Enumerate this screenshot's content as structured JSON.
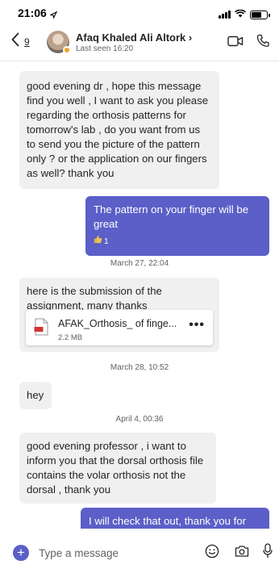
{
  "status_bar": {
    "time": "21:06"
  },
  "header": {
    "back_count": "9",
    "contact_name": "Afaq Khaled Ali Altork ›",
    "contact_status": "Last seen 16:20"
  },
  "messages": [
    {
      "text": "good evening dr , hope this message find you well , I want to ask you please regarding the orthosis patterns for tomorrow's lab , do you want from us to send you the picture of the pattern only ? or the application on our fingers as well? thank you"
    },
    {
      "text": "The pattern on your finger will be great",
      "reaction_count": "1"
    },
    {
      "text": "here is the submission of the assignment, many thanks"
    },
    {
      "text": "hey"
    },
    {
      "text": "good evening professor , i want to inform you that the dorsal orthosis file contains  the volar orthosis  not the dorsal , thank you"
    },
    {
      "text": "I will check that out, thank you for letting me know"
    }
  ],
  "timestamps": [
    "March 27, 22:04",
    "March 28, 10:52",
    "April 4, 00:36"
  ],
  "attachment": {
    "name": "AFAK_Orthosis_ of finge...",
    "size": "2.2 MB"
  },
  "composer": {
    "placeholder": "Type a message"
  },
  "colors": {
    "accent": "#5b5fc7",
    "incoming_bubble": "#f0f0f0",
    "presence": "#f2a12b"
  }
}
